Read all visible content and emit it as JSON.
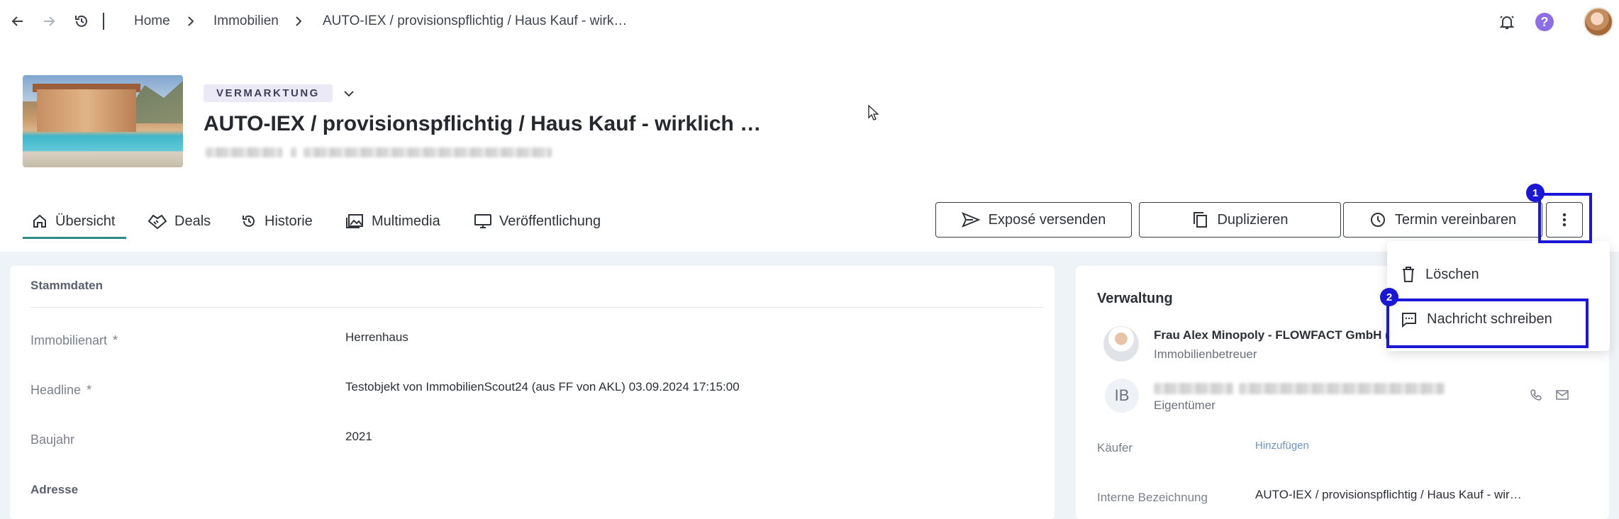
{
  "breadcrumb": {
    "items": [
      "Home",
      "Immobilien",
      "AUTO-IEX / provisionspflichtig / Haus Kauf - wirk…"
    ]
  },
  "header": {
    "status": "VERMARKTUNG",
    "title": "AUTO-IEX / provisionspflichtig / Haus Kauf - wirklich …"
  },
  "tabs": [
    {
      "label": "Übersicht",
      "icon": "home-icon",
      "active": true
    },
    {
      "label": "Deals",
      "icon": "handshake-icon"
    },
    {
      "label": "Historie",
      "icon": "history-icon"
    },
    {
      "label": "Multimedia",
      "icon": "images-icon"
    },
    {
      "label": "Veröffentlichung",
      "icon": "monitor-icon"
    }
  ],
  "actions": {
    "expose": "Exposé versenden",
    "duplicate": "Duplizieren",
    "appointment": "Termin vereinbaren"
  },
  "stammdaten": {
    "title": "Stammdaten",
    "fields": [
      {
        "label": "Immobilienart",
        "required": "*",
        "value": "Herrenhaus"
      },
      {
        "label": "Headline",
        "required": "*",
        "value": "Testobjekt von ImmobilienScout24 (aus FF von AKL) 03.09.2024 17:15:00"
      },
      {
        "label": "Baujahr",
        "value": "2021"
      }
    ],
    "address_title": "Adresse"
  },
  "verwaltung": {
    "title": "Verwaltung",
    "manager_name": "Frau Alex Minopoly - FLOWFACT GmbH (T",
    "manager_role": "Immobilienbetreuer",
    "owner_initials": "IB",
    "owner_role": "Eigentümer",
    "buyer_label": "Käufer",
    "buyer_action": "Hinzufügen",
    "internal_label": "Interne Bezeichnung",
    "internal_value": "AUTO-IEX / provisionspflichtig / Haus Kauf - wir…"
  },
  "menu": {
    "delete": "Löschen",
    "message": "Nachricht schreiben"
  },
  "annotations": {
    "badge1": "1",
    "badge2": "2"
  },
  "colors": {
    "accent": "#2e8b86",
    "highlight": "#1a17d6",
    "help": "#8e6ee8",
    "status_bg": "#ebe9f8"
  }
}
